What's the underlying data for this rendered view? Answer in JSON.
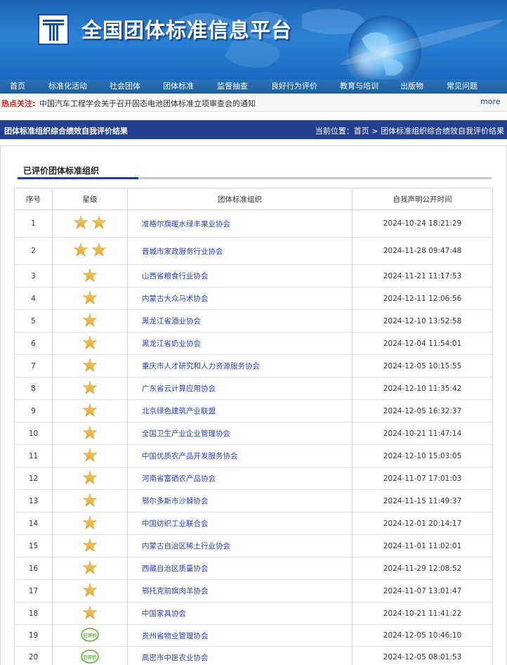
{
  "site": {
    "title": "全国团体标准信息平台"
  },
  "nav": [
    "首页",
    "标准化活动",
    "社会团体",
    "团体标准",
    "监督抽查",
    "良好行为评价",
    "教育与培训",
    "出版物",
    "常见问题"
  ],
  "hot": {
    "label": "热点关注:",
    "text": "中国汽车工程学会关于召开固态电池团体标准立项审查会的通知",
    "more": "more"
  },
  "section": {
    "title": "团体标准组织综合绩效自我评价结果",
    "breadcrumb": "当前位置：首页 > 团体标准组织综合绩效自我评价结果"
  },
  "subsection": {
    "title": "已评价团体标准组织"
  },
  "table": {
    "headers": [
      "序号",
      "星级",
      "团体标准组织",
      "自我声明公开时间"
    ],
    "rows": [
      {
        "no": "1",
        "rating": "2",
        "org": "准格尔旗暖水绿丰果业协会",
        "time": "2024-10-24 18:21:29"
      },
      {
        "no": "2",
        "rating": "2",
        "org": "晋城市家政服务行业协会",
        "time": "2024-11-28 09:47:48"
      },
      {
        "no": "3",
        "rating": "1",
        "org": "山西省粮食行业协会",
        "time": "2024-11-21 11:17:53"
      },
      {
        "no": "4",
        "rating": "1",
        "org": "内蒙古大众马术协会",
        "time": "2024-12-11 12:06:56"
      },
      {
        "no": "5",
        "rating": "1",
        "org": "黑龙江省酒业协会",
        "time": "2024-12-10 13:52:58"
      },
      {
        "no": "6",
        "rating": "1",
        "org": "黑龙江省奶业协会",
        "time": "2024-12-04 11:54:01"
      },
      {
        "no": "7",
        "rating": "1",
        "org": "重庆市人才研究和人力资源服务协会",
        "time": "2024-12-05 10:15:55"
      },
      {
        "no": "8",
        "rating": "1",
        "org": "广东省云计算应用协会",
        "time": "2024-12-10 11:35:42"
      },
      {
        "no": "9",
        "rating": "1",
        "org": "北京绿色建筑产业联盟",
        "time": "2024-12-05 16:32:37"
      },
      {
        "no": "10",
        "rating": "1",
        "org": "全国卫生产业企业管理协会",
        "time": "2024-10-21 11:47:14"
      },
      {
        "no": "11",
        "rating": "1",
        "org": "中国优质农产品开发服务协会",
        "time": "2024-12-10 15:03:05"
      },
      {
        "no": "12",
        "rating": "1",
        "org": "河南省富硒农产品协会",
        "time": "2024-11-07 17:01:03"
      },
      {
        "no": "13",
        "rating": "1",
        "org": "鄂尔多斯市沙棘协会",
        "time": "2024-11-15 11:49:37"
      },
      {
        "no": "14",
        "rating": "1",
        "org": "中国纺织工业联合会",
        "time": "2024-12-01 20:14:17"
      },
      {
        "no": "15",
        "rating": "1",
        "org": "内蒙古自治区稀土行业协会",
        "time": "2024-11-01 11:02:01"
      },
      {
        "no": "16",
        "rating": "1",
        "org": "西藏自治区质量协会",
        "time": "2024-11-29 12:08:52"
      },
      {
        "no": "17",
        "rating": "1",
        "org": "鄂托克前旗肉羊协会",
        "time": "2024-11-07 13:01:47"
      },
      {
        "no": "18",
        "rating": "1",
        "org": "中国家具协会",
        "time": "2024-10-21 11:41:22"
      },
      {
        "no": "19",
        "rating": "已评价",
        "org": "贵州省物业管理协会",
        "time": "2024-12-05 10:46:10"
      },
      {
        "no": "20",
        "rating": "已评价",
        "org": "高密市中医农业协会",
        "time": "2024-12-05 08:01:53"
      }
    ]
  },
  "colors": {
    "banner": "#2d82d6",
    "nav": "#2a71b6",
    "section_bar": "#23408e",
    "hot_label": "#d12a1f",
    "link": "#2a3fa8",
    "star": "#e0a630",
    "badge": "#5ab13b"
  }
}
